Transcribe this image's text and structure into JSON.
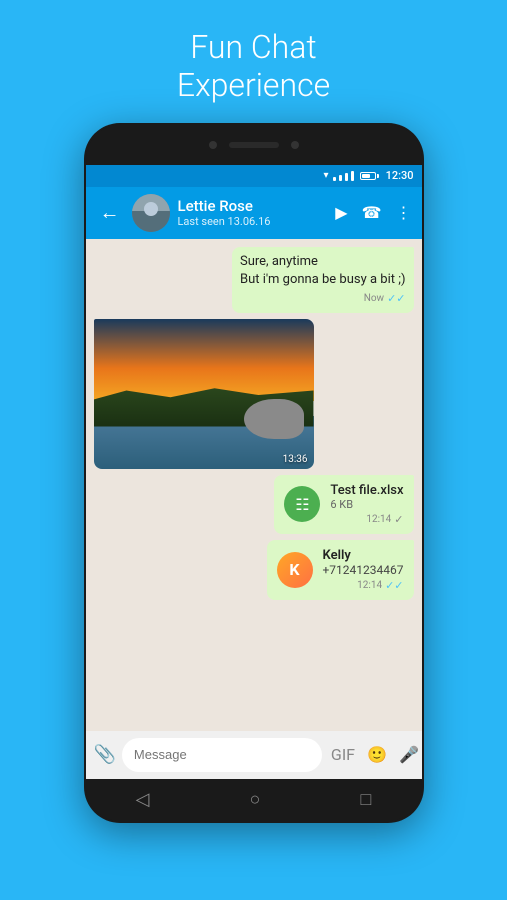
{
  "header": {
    "title": "Fun Chat",
    "subtitle": "Experience"
  },
  "statusBar": {
    "time": "12:30"
  },
  "appBar": {
    "contactName": "Lettie Rose",
    "contactStatus": "Last seen 13.06.16"
  },
  "chat": {
    "messages": [
      {
        "id": "msg1",
        "type": "sent",
        "text": "Sure, anytime\nBut i'm gonna be busy a bit ;)",
        "time": "Now",
        "status": "read"
      },
      {
        "id": "msg2",
        "type": "received-image",
        "timestamp": "13:36"
      },
      {
        "id": "msg3",
        "type": "file",
        "fileName": "Test file.xlsx",
        "fileSize": "6 KB",
        "time": "12:14",
        "status": "sent"
      },
      {
        "id": "msg4",
        "type": "contact",
        "contactInitial": "K",
        "contactName": "Kelly",
        "contactPhone": "+71241234467",
        "time": "12:14",
        "status": "read"
      }
    ]
  },
  "inputBar": {
    "placeholder": "Message",
    "gifLabel": "GIF"
  },
  "bottomNav": {
    "back": "◁",
    "home": "○",
    "recent": "□"
  }
}
